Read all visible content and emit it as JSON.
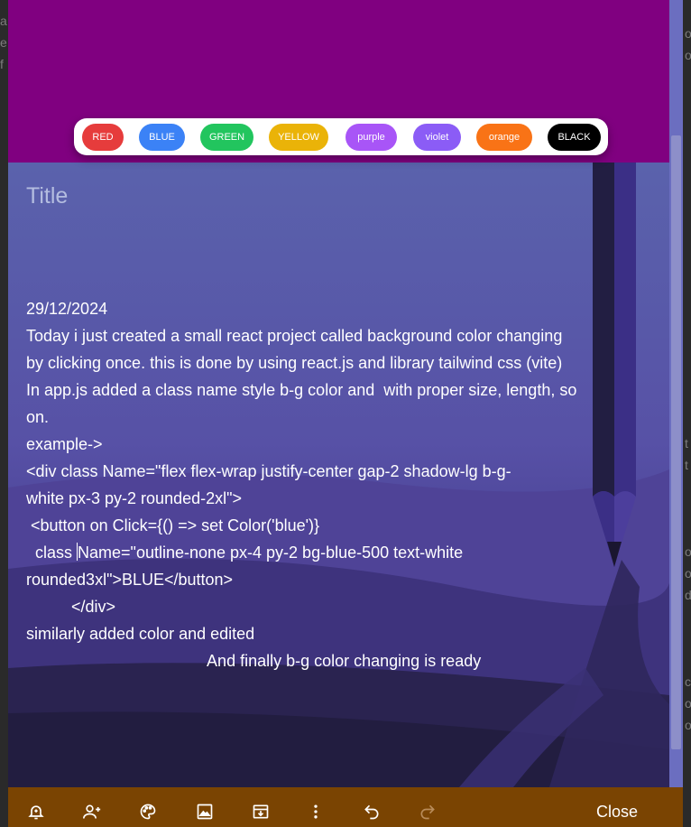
{
  "background_window": {
    "left_fragments": [
      "a",
      "e",
      "f"
    ],
    "right_fragments": [
      "o",
      "o",
      "t",
      "t",
      "o",
      "o",
      "d",
      "c",
      "o",
      "o"
    ]
  },
  "color_buttons": [
    {
      "label": "RED",
      "color": "#e63c3c",
      "text_color": "#ffffff"
    },
    {
      "label": "BLUE",
      "color": "#3b82f6",
      "text_color": "#ffffff"
    },
    {
      "label": "GREEN",
      "color": "#22c55e",
      "text_color": "#ffffff"
    },
    {
      "label": "YELLOW",
      "color": "#eab308",
      "text_color": "#ffffff"
    },
    {
      "label": "purple",
      "color": "#a855f7",
      "text_color": "#ffffff"
    },
    {
      "label": "violet",
      "color": "#8b5cf6",
      "text_color": "#ffffff"
    },
    {
      "label": "orange",
      "color": "#f97316",
      "text_color": "#ffffff"
    },
    {
      "label": "BLACK",
      "color": "#000000",
      "text_color": "#ffffff"
    }
  ],
  "banner_color": "#800080",
  "note": {
    "title_placeholder": "Title",
    "lines": [
      "29/12/2024",
      "Today i just created a small react project called background color changing",
      "by clicking once. this is done by using react.js and library tailwind css (vite)",
      "",
      "In app.js added a class name style b-g color and  with proper size, length, so",
      "on.",
      "example->",
      "",
      "<div class Name=\"flex flex-wrap justify-center gap-2 shadow-lg b-g-",
      "white px-3 py-2 rounded-2xl\">",
      " <button on Click={() => set Color('blue')}",
      "  class ",
      "rounded3xl\">BLUE</button>",
      "          </div>",
      "similarly added color and edited",
      "",
      "                                        And finally b-g color changing is ready"
    ],
    "caret_line_rest": "Name=\"outline-none px-4 py-2 bg-blue-500 text-white"
  },
  "toolbar": {
    "icons": [
      "remind-icon",
      "collaborator-icon",
      "palette-icon",
      "image-icon",
      "archive-icon",
      "more-icon",
      "undo-icon",
      "redo-icon"
    ],
    "close_label": "Close",
    "bar_color": "#7a4402"
  }
}
